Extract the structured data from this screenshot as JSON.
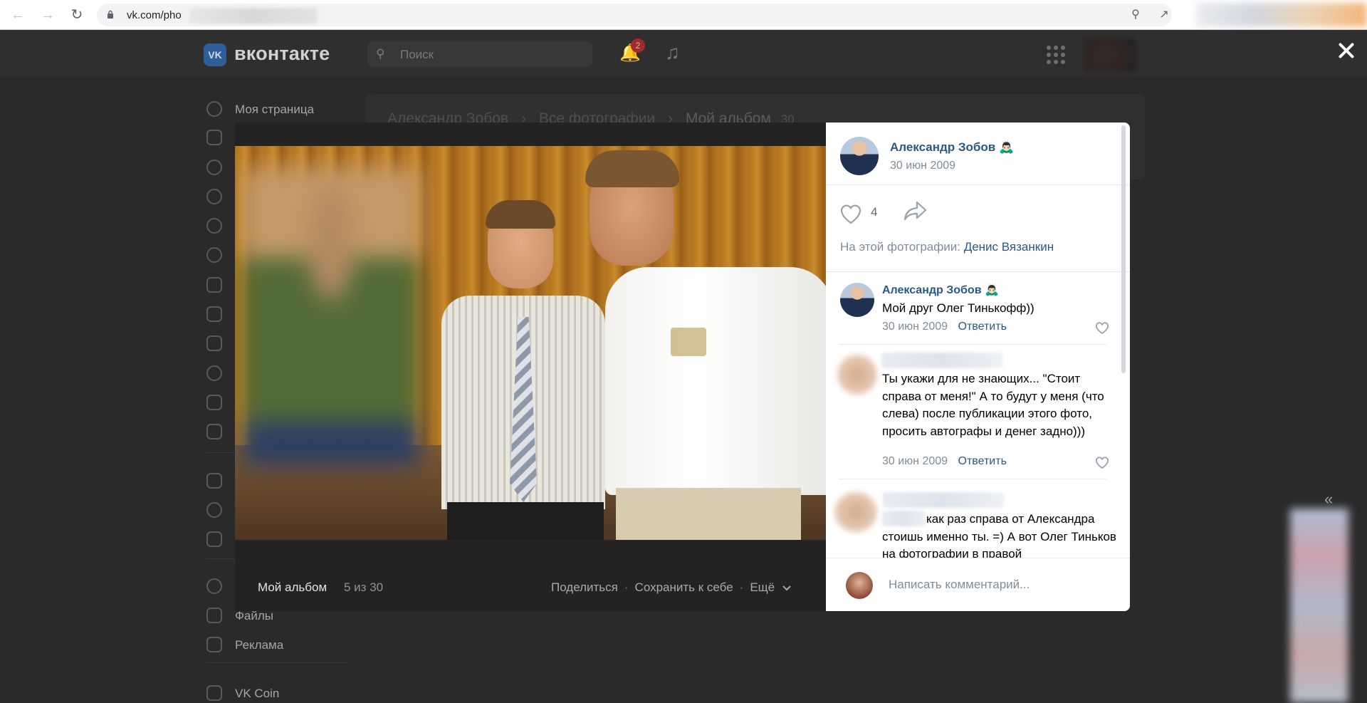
{
  "browser": {
    "url": "vk.com/pho",
    "icons": [
      "back-icon",
      "forward-icon",
      "reload-icon",
      "lock-icon",
      "zoom-icon",
      "share-icon"
    ]
  },
  "header": {
    "logo_text": "вконтакте",
    "search_placeholder": "Поиск",
    "notifications_count": "2"
  },
  "sidebar": {
    "items": [
      {
        "label": "Моя страница",
        "icon": "user-circle-icon"
      },
      {
        "label": "",
        "icon": "news-icon"
      },
      {
        "label": "",
        "icon": "messages-icon"
      },
      {
        "label": "",
        "icon": "calls-icon"
      },
      {
        "label": "",
        "icon": "friends-icon"
      },
      {
        "label": "",
        "icon": "communities-icon"
      },
      {
        "label": "",
        "icon": "photos-icon"
      },
      {
        "label": "",
        "icon": "music-icon"
      },
      {
        "label": "",
        "icon": "video-icon"
      },
      {
        "label": "",
        "icon": "clips-icon"
      },
      {
        "label": "",
        "icon": "games-icon"
      },
      {
        "label": "",
        "icon": "bookmarks-icon"
      },
      {
        "label": "",
        "icon": "apps-icon"
      },
      {
        "label": "",
        "icon": "payments-icon"
      },
      {
        "label": "",
        "icon": "work-icon"
      },
      {
        "label": "",
        "icon": "star-icon"
      },
      {
        "label": "Файлы",
        "icon": "files-icon"
      },
      {
        "label": "Реклама",
        "icon": "ads-icon"
      },
      {
        "label": "VK Coin",
        "icon": "vkcoin-icon"
      }
    ]
  },
  "background_breadcrumb": {
    "owner": "Александр Зобов",
    "all_photos": "Все фотографии",
    "album": "Мой альбом",
    "count": "30"
  },
  "viewer": {
    "album_name": "Мой альбом",
    "position": "5 из 30",
    "actions": {
      "share": "Поделиться",
      "save": "Сохранить к себе",
      "more": "Ещё"
    }
  },
  "panel": {
    "author": {
      "name": "Александр Зобов 🙇🏻‍♂️",
      "date": "30 июн 2009"
    },
    "likes": "4",
    "tagged_label": "На этой фотографии:",
    "tagged_person": "Денис Вязанкин",
    "comments": [
      {
        "author": "Александр Зобов 🙇🏻‍♂️",
        "text": "Мой друг Олег Тинькофф))",
        "date": "30 июн 2009",
        "reply": "Ответить"
      },
      {
        "author": "",
        "text": "Ты укажи для не знающих... \"Стоит справа от меня!\" А то будут у меня (что слева) после публикации этого фото, просить автографы и денег задно)))",
        "date": "30 июн 2009",
        "reply": "Ответить"
      },
      {
        "author": "",
        "text": "как раз справа от Александра стоишь именно ты. =) А вот Олег Тиньков на фотографии в правой",
        "date": "",
        "reply": ""
      }
    ],
    "compose_placeholder": "Написать комментарий..."
  },
  "colors": {
    "link": "#2a5885",
    "muted": "#818c99",
    "overlay_bg": "#2a2a2a",
    "badge": "#a12b2b"
  }
}
